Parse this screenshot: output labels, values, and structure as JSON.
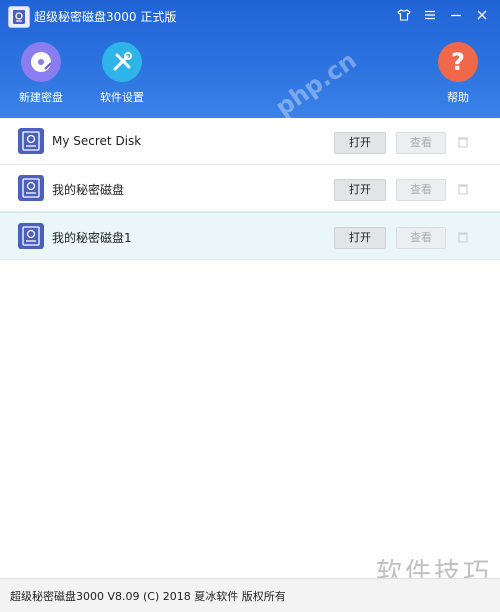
{
  "window": {
    "title": "超级秘密磁盘3000 正式版",
    "controls": [
      "shirt-icon",
      "menu-icon",
      "minimize-icon",
      "close-icon"
    ]
  },
  "toolbar": {
    "new_disk_label": "新建密盘",
    "settings_label": "软件设置",
    "help_label": "帮助",
    "help_symbol": "?",
    "colors": {
      "new": "#8a7df0",
      "settings": "#2fb4ea",
      "help": "#f0684a"
    }
  },
  "watermark": "php.cn",
  "disks": [
    {
      "name": "My Secret Disk",
      "open_label": "打开",
      "view_label": "查看",
      "selected": false
    },
    {
      "name": "我的秘密磁盘",
      "open_label": "打开",
      "view_label": "查看",
      "selected": false
    },
    {
      "name": "我的秘密磁盘1",
      "open_label": "打开",
      "view_label": "查看",
      "selected": true
    }
  ],
  "footer": {
    "text": "超级秘密磁盘3000 V8.09 (C) 2018 夏冰软件 版权所有"
  },
  "corner_watermark": "软件技巧"
}
